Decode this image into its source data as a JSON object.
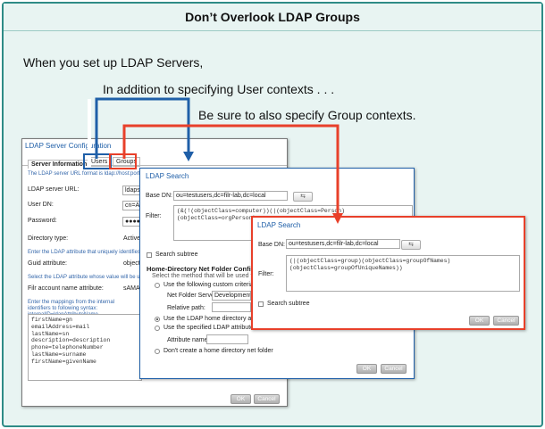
{
  "headline": "Don’t Overlook LDAP Groups",
  "callouts": {
    "line1": "When you set up LDAP Servers,",
    "line2": "In addition to specifying User contexts . . .",
    "line3": "Be sure to also specify Group contexts."
  },
  "colors": {
    "frame": "#2e8b86",
    "user_arrow": "#1f5fa8",
    "group_arrow": "#e8402a"
  },
  "back_window": {
    "title": "LDAP Server Configuration",
    "tabs": [
      "Server Information",
      "Users",
      "Groups"
    ],
    "url_hint": "The LDAP server URL format is ldap://host:port/",
    "url_label": "LDAP server URL:",
    "url_value": "ldaps",
    "dn_label": "User DN:",
    "dn_value": "cn=Ad",
    "password_label": "Password:",
    "password_value": "●●●●●",
    "dirtype_label": "Directory type:",
    "dirtype_value": "Active",
    "guid_hint": "Enter the LDAP attribute that uniquely identifies a",
    "guid_label": "Guid attribute:",
    "guid_value": "object",
    "account_hint": "Select the LDAP attribute whose value will be used",
    "account_label": "Filr account name attribute:",
    "account_value": "sAMA",
    "mapping_hint": "Enter the mappings from the internal identifiers to following syntax: internalID=ldapAttributeName",
    "mappings": "firstName=gn\nemailAddress=mail\nlastName=sn\ndescription=description\nphone=telephoneNumber\nlastName=surname\nfirstName=givenName",
    "ok": "OK",
    "cancel": "Cancel"
  },
  "users_window": {
    "title": "LDAP Search",
    "base_dn_label": "Base DN:",
    "base_dn_value": "ou=testusers,dc=filr-lab,dc=local",
    "filter_label": "Filter:",
    "filter_value": "(&(!(objectClass=computer))(|(objectClass=Person)\n(objectClass=orgPerson)",
    "subtree_label": "Search subtree",
    "home_heading": "Home-Directory Net Folder Configu",
    "home_hint": "Select the method that will be used t",
    "opt_custom": "Use the following custom criteria",
    "server_label": "Net Folder Server:",
    "server_value": "Development",
    "relpath_label": "Relative path:",
    "opt_home_attr": "Use the LDAP home directory attribut",
    "opt_specified": "Use the specified LDAP attribute",
    "attr_name_label": "Attribute name:",
    "opt_dont": "Don't create a home directory net folder",
    "ok": "OK",
    "cancel": "Cancel"
  },
  "groups_window": {
    "title": "LDAP Search",
    "base_dn_label": "Base DN:",
    "base_dn_value": "ou=testusers,dc=filr-lab,dc=local",
    "filter_label": "Filter:",
    "filter_value": "(|(objectClass=group)(objectClass=groupOfNames)\n(objectClass=groupOfUniqueNames))",
    "subtree_label": "Search subtree",
    "ok": "OK",
    "cancel": "Cancel"
  }
}
